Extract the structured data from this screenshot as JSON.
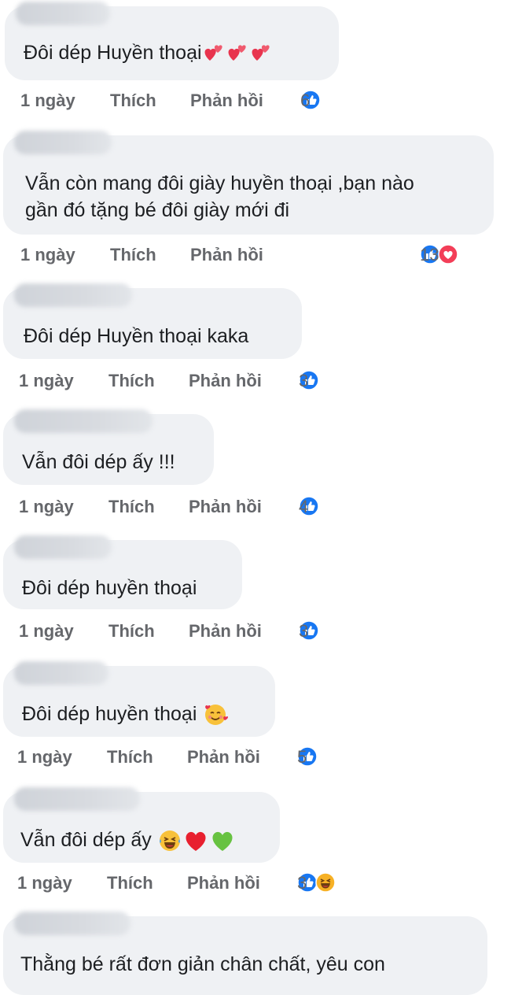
{
  "actions": {
    "time": "1 ngày",
    "like": "Thích",
    "reply": "Phản hồi"
  },
  "comments": [
    {
      "text": "Đôi dép Huyền thoại",
      "count": "6",
      "reactions": [
        "like"
      ],
      "emojis": [
        "heart-pair",
        "heart-pair",
        "heart-pair"
      ]
    },
    {
      "text_lines": [
        "Vẫn còn mang đôi giày huyền thoại ,bạn nào",
        "gần đó tặng bé đôi giày mới đi"
      ],
      "count": "13",
      "reactions": [
        "like",
        "love"
      ]
    },
    {
      "text": "Đôi dép Huyền thoại kaka",
      "count": "3",
      "reactions": [
        "like"
      ]
    },
    {
      "text": "Vẫn đôi dép ấy !!!",
      "count": "4",
      "reactions": [
        "like"
      ]
    },
    {
      "text": "Đôi dép huyền thoại",
      "count": "3",
      "reactions": [
        "like"
      ]
    },
    {
      "text": "Đôi dép huyền thoại",
      "count": "5",
      "reactions": [
        "like"
      ],
      "emojis": [
        "smiling-face-with-hearts"
      ]
    },
    {
      "text": "Vẫn đôi dép ấy",
      "count": "3",
      "reactions": [
        "like",
        "haha"
      ],
      "emojis": [
        "laughing-face",
        "red-heart",
        "green-heart"
      ]
    },
    {
      "text": "Thằng bé rất đơn giản chân chất, yêu con"
    }
  ],
  "colors": {
    "like": "#1877f2",
    "love": "#f33e58",
    "haha": "#f7b125",
    "bubble": "#eff1f4",
    "meta": "#65676b"
  }
}
